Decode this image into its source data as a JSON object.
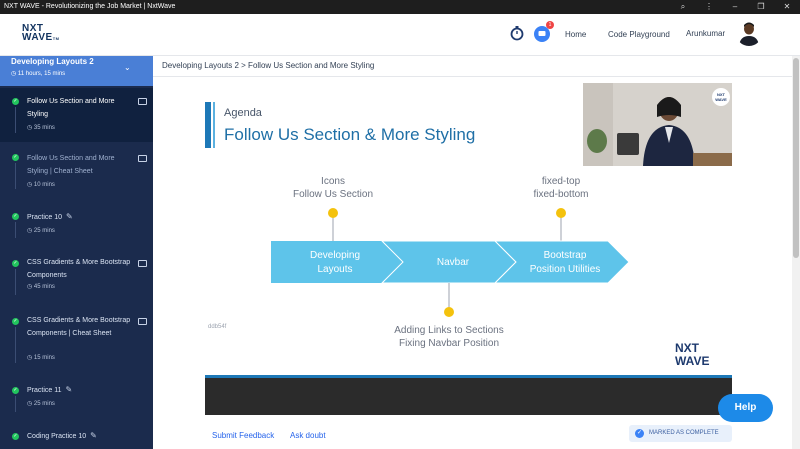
{
  "window": {
    "title": "NXT WAVE - Revolutionizing the Job Market | NxtWave"
  },
  "header": {
    "logo_line1": "NXT",
    "logo_line2": "WAVE",
    "logo_tm": "TM",
    "notification_count": "1",
    "nav": [
      "Home",
      "Code Playground"
    ],
    "user_name": "Arunkumar"
  },
  "sidebar": {
    "course_title": "Developing Layouts 2",
    "course_duration": "11 hours, 15 mins",
    "items": [
      {
        "label": "Follow Us Section and More Styling",
        "duration": "35 mins"
      },
      {
        "label": "Follow Us Section and More Styling | Cheat Sheet",
        "duration": "10 mins"
      },
      {
        "label": "Practice 10",
        "duration": "25 mins"
      },
      {
        "label": "CSS Gradients & More Bootstrap Components",
        "duration": "45 mins"
      },
      {
        "label": "CSS Gradients & More Bootstrap Components | Cheat Sheet",
        "duration": "15 mins"
      },
      {
        "label": "Practice 11",
        "duration": "25 mins"
      },
      {
        "label": "Coding Practice 10",
        "duration": ""
      }
    ]
  },
  "breadcrumb": "Developing Layouts 2 > Follow Us Section and More Styling",
  "slide": {
    "kicker": "Agenda",
    "title": "Follow Us Section & More Styling",
    "top_notes": [
      "Icons\nFollow Us Section",
      "fixed-top\nfixed-bottom"
    ],
    "arrows": [
      "Developing\nLayouts",
      "Navbar",
      "Bootstrap\nPosition Utilities"
    ],
    "bottom_note": "Adding Links to Sections\nFixing Navbar Position",
    "watermark": "ddb54f",
    "logo_line1": "NXT",
    "logo_line2": "WAVE"
  },
  "actions": {
    "feedback": "Submit Feedback",
    "doubt": "Ask doubt",
    "complete": "MARKED AS COMPLETE"
  },
  "help_label": "Help",
  "colors": {
    "sidebar_bg": "#1b2b4d",
    "sidebar_header": "#4a7fd6",
    "arrow": "#5ec4ea",
    "accent": "#1f6fa6",
    "dot": "#f4c20d",
    "complete_green": "#22c55e"
  }
}
